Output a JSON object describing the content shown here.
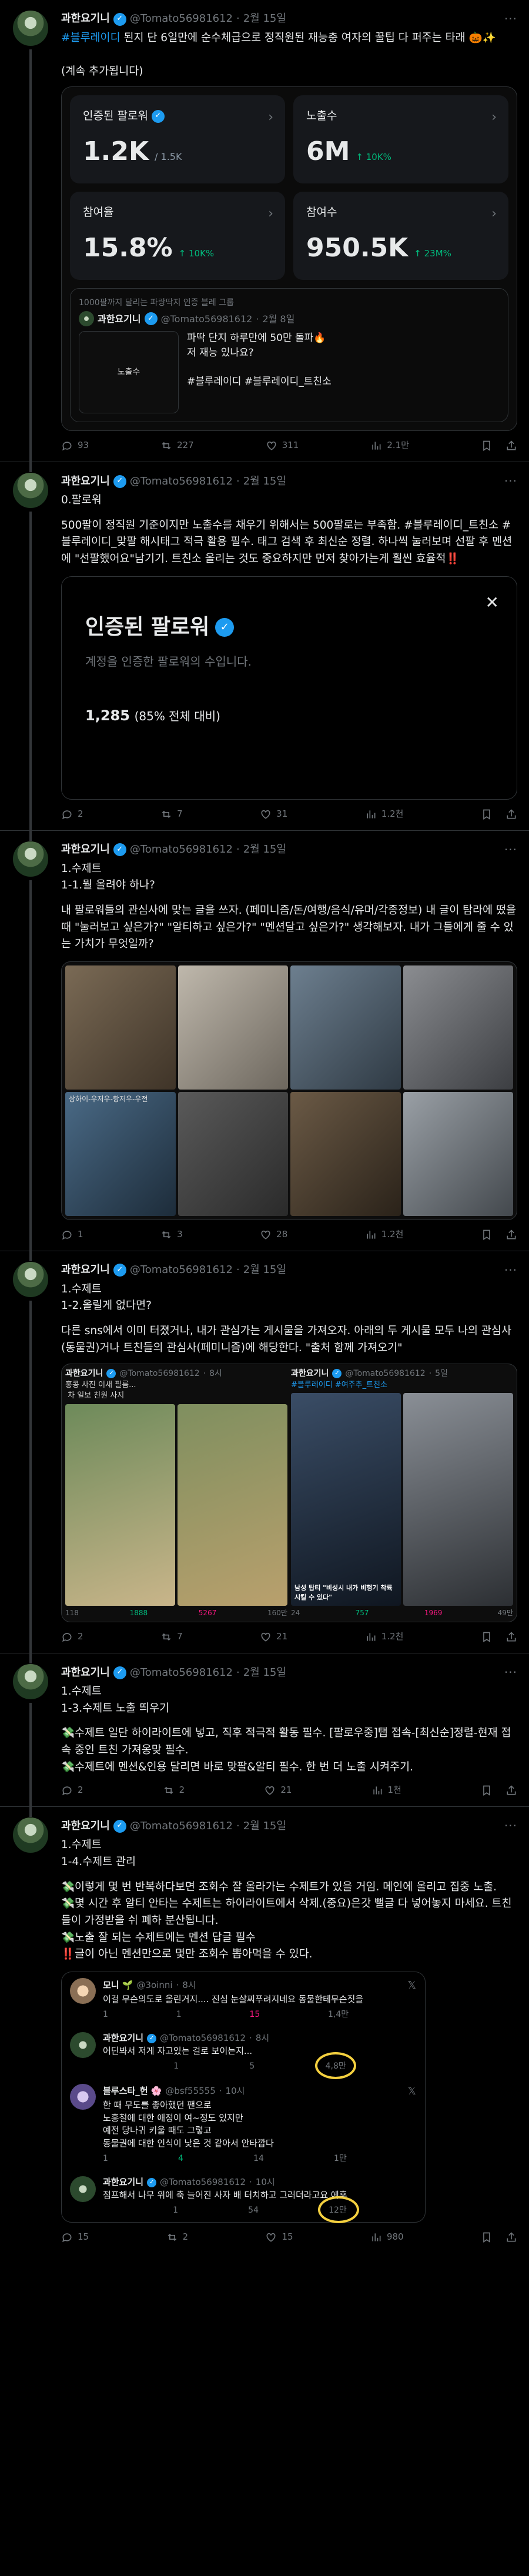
{
  "author": {
    "name": "과한요기니",
    "handle": "@Tomato56981612"
  },
  "tweets": [
    {
      "date": "2월 15일",
      "body_tag": "#블루레이디",
      "body": " 된지 단 6일만에 순수체급으로 정직원된 재능충 여자의 꿀팁 다 퍼주는 타래 🎃✨\n\n(계속 추가됩니다)",
      "stats": [
        {
          "label": "인증된 팔로워",
          "value": "1.2K",
          "sub": "/ 1.5K",
          "change": ""
        },
        {
          "label": "노출수",
          "value": "6M",
          "sub": "",
          "change": "↑ 10K%"
        },
        {
          "label": "참여율",
          "value": "15.8%",
          "sub": "",
          "change": "↑ 10K%"
        },
        {
          "label": "참여수",
          "value": "950.5K",
          "sub": "",
          "change": "↑ 23M%"
        }
      ],
      "quote": {
        "context": "1000팔까지 달리는 파랑딱지 인증 블레 그룹",
        "date": "2월 8일",
        "text": "파딱 단지 하루만에 50만 돌파🔥\n저 재능 있나요?\n\n#블루레이디 #블루레이디_트친소",
        "thumb_label": "노출수"
      },
      "counts": {
        "reply": "93",
        "retweet": "227",
        "like": "311",
        "views": "2.1만"
      }
    },
    {
      "date": "2월 15일",
      "title": "0.팔로워",
      "body": "500팔이 정직원 기준이지만 노출수를 채우기 위해서는 500팔로는 부족함. #블루레이디_트친소 #블루레이디_맞팔 해시태그 적극 활용 필수. 태그 검색 후 최신순 정렬. 하나씩 눌러보며 선팔 후 멘션에 \"선팔했어요\"남기기. 트친소 올리는 것도 중요하지만 먼저 찾아가는게 훨씬 효율적‼️",
      "dialog": {
        "title": "인증된 팔로워",
        "desc": "계정을 인증한 팔로워의 수입니다.",
        "count": "1,285",
        "pct": "(85% 전체 대비)"
      },
      "counts": {
        "reply": "2",
        "retweet": "7",
        "like": "31",
        "views": "1.2천"
      }
    },
    {
      "date": "2월 15일",
      "title": "1.수제트\n1-1.뭘 올려야 하나?",
      "body": "내 팔로워들의 관심사에 맞는 글을 쓰자. (페미니즘/돈/여행/음식/유머/각종정보) 내 글이 탐라에 떴을 때 \"눌러보고 싶은가?\" \"알티하고 싶은가?\" \"멘션달고 싶은가?\" 생각해보자. 내가 그들에게 줄 수 있는 가치가 무엇일까?",
      "img_labels": [
        "상하이-우저우-항저우-우전"
      ],
      "counts": {
        "reply": "1",
        "retweet": "3",
        "like": "28",
        "views": "1.2천"
      }
    },
    {
      "date": "2월 15일",
      "title": "1.수제트\n1-2.올릴게 없다면?",
      "body": "다른 sns에서 이미 터졌거나, 내가 관심가는 게시물을 가져오자. 아래의 두 게시물 모두 나의 관심사(동물권)거나 트친들의 관심사(페미니즘)에 해당한다. \"출처 함께 가져오기\"",
      "inner": [
        {
          "author": "과한요기니",
          "handle": "@Tomato56981612",
          "date": "8시",
          "text": "홍콩 사진 이새 필름...\n 차 일보 친원 사지",
          "counts": [
            "118",
            "1888",
            "5267",
            "160만"
          ]
        },
        {
          "author": "과한요기니",
          "handle": "@Tomato56981612",
          "date": "5일",
          "text": "#블루레이디 #여주추_트친소",
          "caption": "남성 탑티 \"비성시 내가 비행기 착륙시킬 수 있다\"",
          "counts": [
            "24",
            "757",
            "1969",
            "49만"
          ]
        }
      ],
      "counts": {
        "reply": "2",
        "retweet": "7",
        "like": "21",
        "views": "1.2천"
      }
    },
    {
      "date": "2월 15일",
      "title": "1.수제트\n1-3.수제트 노출 띄우기",
      "body": "💸수제트 일단 하이라이트에 넣고, 직후 적극적 활동 필수. [팔로우중]탭 접속-[최신순]정렬-현재 접속 중인 트친 가져옹맞 필수.\n💸수제트에 멘션&인용 달리면 바로 맞팔&알티 필수. 한 번 더 노출 시켜주기.",
      "counts": {
        "reply": "2",
        "retweet": "2",
        "like": "21",
        "views": "1천"
      }
    },
    {
      "date": "2월 15일",
      "title": "1.수제트\n1-4.수제트 관리",
      "body": "💸이렇게 몇 번 반복하다보면 조회수 잘 올라가는 수제트가 있을 거임. 메인에 올리고 집중 노출.\n💸몇 시간 후 알티 안타는 수제트는 하이라이트에서 삭제.(중요)은갓 뻘글 다 넣어놓지 마세요. 트친들이 가정받을 쉬 폐하 분산됩니다.\n💸노출 잘 되는 수제트에는 멘션 답글 필수\n‼️글이 아닌 멘션만으로 몇만 조회수 뽑아먹을 수 있다.",
      "replies": [
        {
          "name": "모니 🌱",
          "handle": "@3oinni",
          "date": "8시",
          "text": "이걸 무슨의도로 올린거지.... 진심 눈살찌푸려지네요 동물한테무슨짓을",
          "counts": [
            "1",
            "1",
            "15",
            "1,4만"
          ]
        },
        {
          "name": "과한요기니",
          "handle": "@Tomato56981612",
          "date": "8시",
          "text": "어딘봐서 저게 자고있는 걸로 보이는지...",
          "counts": [
            "",
            "1",
            "5",
            "4,8만"
          ]
        },
        {
          "name": "블루스타_헌 🌸",
          "handle": "@bsf55555",
          "date": "10시",
          "text": "한 때 무도를 좋아했던 팬으로\n노홍철에 대한 애정이 여~정도 있지만\n예전 당나귀 키울 때도 그렇고\n동물권에 대한 인식이 낮은 것 같아서 안타깝다",
          "counts": [
            "1",
            "4",
            "14",
            "1만"
          ]
        },
        {
          "name": "과한요기니",
          "handle": "@Tomato56981612",
          "date": "10시",
          "text": "점프해서 나무 위에 축 늘어진 사자 배 터치하고 그러더라고요 에후",
          "counts": [
            "",
            "1",
            "54",
            "12만"
          ]
        }
      ],
      "counts": {
        "reply": "15",
        "retweet": "2",
        "like": "15",
        "views": "980"
      }
    }
  ]
}
